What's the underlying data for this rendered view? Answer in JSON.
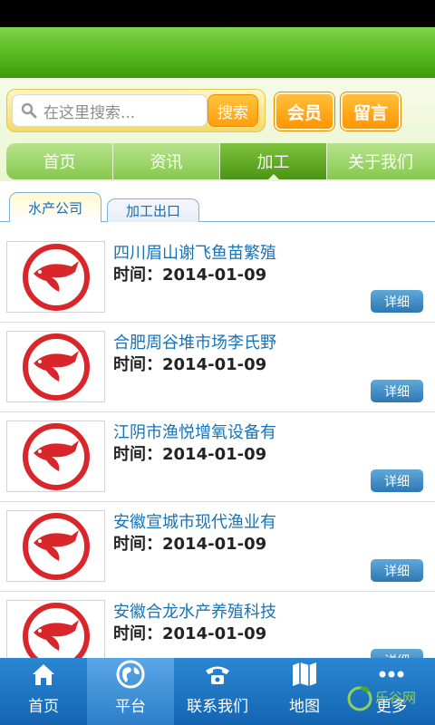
{
  "search": {
    "placeholder": "在这里搜索...",
    "button": "搜索"
  },
  "header_buttons": {
    "member": "会员",
    "message": "留言"
  },
  "nav": [
    "首页",
    "资讯",
    "加工",
    "关于我们"
  ],
  "sub_tabs": [
    "水产公司",
    "加工出口"
  ],
  "list": {
    "detail_label": "详细",
    "items": [
      {
        "title": "四川眉山谢飞鱼苗繁殖",
        "time": "时间：2014-01-09"
      },
      {
        "title": "合肥周谷堆市场李氏野",
        "time": "时间：2014-01-09"
      },
      {
        "title": "江阴市渔悦增氧设备有",
        "time": "时间：2014-01-09"
      },
      {
        "title": "安徽宣城市现代渔业有",
        "time": "时间：2014-01-09"
      },
      {
        "title": "安徽合龙水产养殖科技",
        "time": "时间：2014-01-09"
      }
    ]
  },
  "bottom_tabs": [
    "首页",
    "平台",
    "联系我们",
    "地图",
    "更多"
  ],
  "watermark": {
    "name": "乐谷网"
  },
  "colors": {
    "header_green": "#56b81e",
    "nav_active": "#4a9512",
    "title_blue": "#1773b8",
    "bottom_blue": "#1465b1",
    "button_orange": "#ff9e0f"
  },
  "icons": [
    "search-icon",
    "home-icon",
    "globe-icon",
    "phone-icon",
    "map-icon",
    "more-icon",
    "fish-logo-icon"
  ]
}
